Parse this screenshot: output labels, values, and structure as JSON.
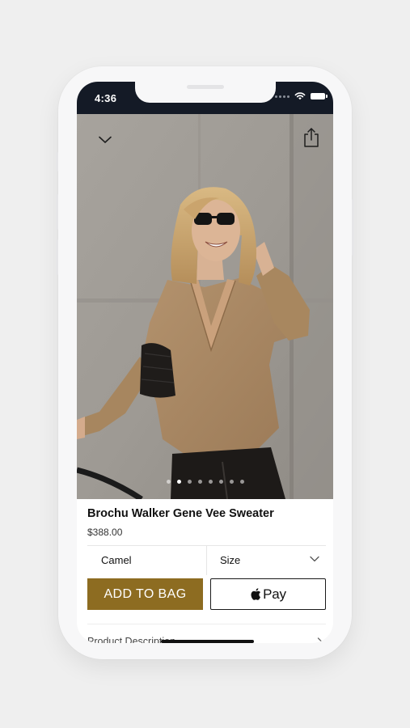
{
  "status_bar": {
    "time": "4:36"
  },
  "product": {
    "title": "Brochu Walker Gene Vee Sweater",
    "price": "$388.00"
  },
  "image_carousel": {
    "page_count": 8,
    "active_index": 1
  },
  "options": {
    "color_value": "Camel",
    "size_label": "Size"
  },
  "actions": {
    "add_to_bag_label": "ADD TO BAG",
    "apple_pay_label": "Pay"
  },
  "description": {
    "label": "Product Description"
  },
  "icons": {
    "collapse": "chevron-down-icon",
    "share": "share-icon",
    "size_dropdown": "chevron-down-icon",
    "apple_logo": "apple-logo-icon",
    "description_expand": "chevron-right-icon"
  },
  "colors": {
    "accent": "#8d6c21",
    "status_bar": "#141a26",
    "background": "#efefef"
  }
}
